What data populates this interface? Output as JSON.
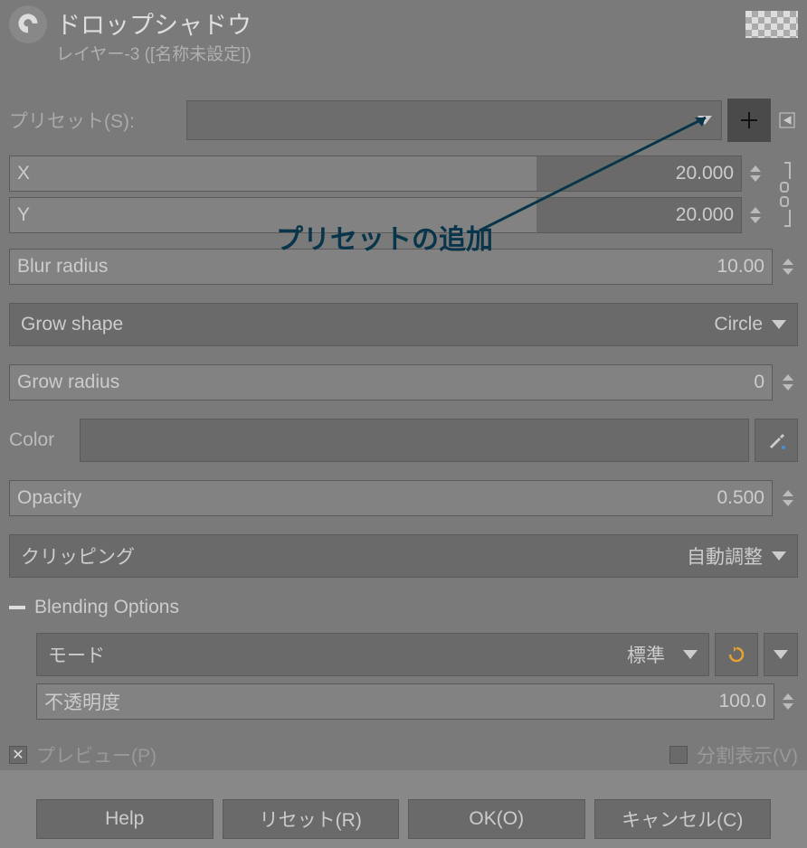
{
  "title": "ドロップシャドウ",
  "subtitle": "レイヤー-3 ([名称未設定])",
  "preset_label": "プリセット(S):",
  "sliders": {
    "x": {
      "label": "X",
      "value": "20.000",
      "fill": 72
    },
    "y": {
      "label": "Y",
      "value": "20.000",
      "fill": 72
    },
    "blur": {
      "label": "Blur radius",
      "value": "10.00",
      "fill": 100
    },
    "grow_radius": {
      "label": "Grow radius",
      "value": "0",
      "fill": 100
    },
    "opacity": {
      "label": "Opacity",
      "value": "0.500",
      "fill": 100
    },
    "blend_opacity": {
      "label": "不透明度",
      "value": "100.0",
      "fill": 100
    }
  },
  "grow_shape": {
    "label": "Grow shape",
    "value": "Circle"
  },
  "color_label": "Color",
  "clipping": {
    "label": "クリッピング",
    "value": "自動調整"
  },
  "blending_section": "Blending Options",
  "mode": {
    "label": "モード",
    "value": "標準"
  },
  "preview": {
    "label": "プレビュー(P)",
    "checked": true
  },
  "split_view": {
    "label": "分割表示(V)",
    "checked": false
  },
  "buttons": {
    "help": "Help",
    "reset": "リセット(R)",
    "ok": "OK(O)",
    "cancel": "キャンセル(C)"
  },
  "annotation": "プリセットの追加"
}
